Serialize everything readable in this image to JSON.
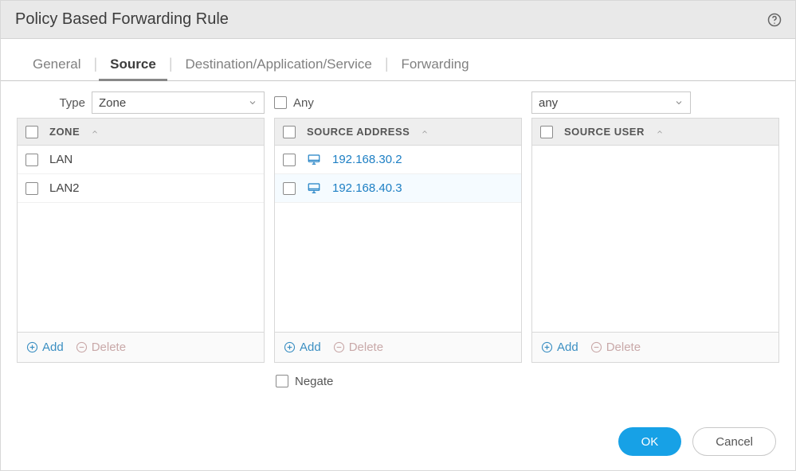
{
  "dialog": {
    "title": "Policy Based Forwarding Rule"
  },
  "tabs": {
    "general": "General",
    "source": "Source",
    "dest": "Destination/Application/Service",
    "forwarding": "Forwarding"
  },
  "type": {
    "label": "Type",
    "value": "Zone"
  },
  "zone": {
    "header": "Zone",
    "rows": [
      {
        "label": "LAN"
      },
      {
        "label": "LAN2"
      }
    ]
  },
  "source_address": {
    "any_label": "Any",
    "header": "Source Address",
    "rows": [
      {
        "label": "192.168.30.2"
      },
      {
        "label": "192.168.40.3"
      }
    ]
  },
  "source_user": {
    "select_value": "any",
    "header": "Source User",
    "rows": []
  },
  "footer": {
    "add": "Add",
    "delete": "Delete"
  },
  "negate_label": "Negate",
  "buttons": {
    "ok": "OK",
    "cancel": "Cancel"
  }
}
